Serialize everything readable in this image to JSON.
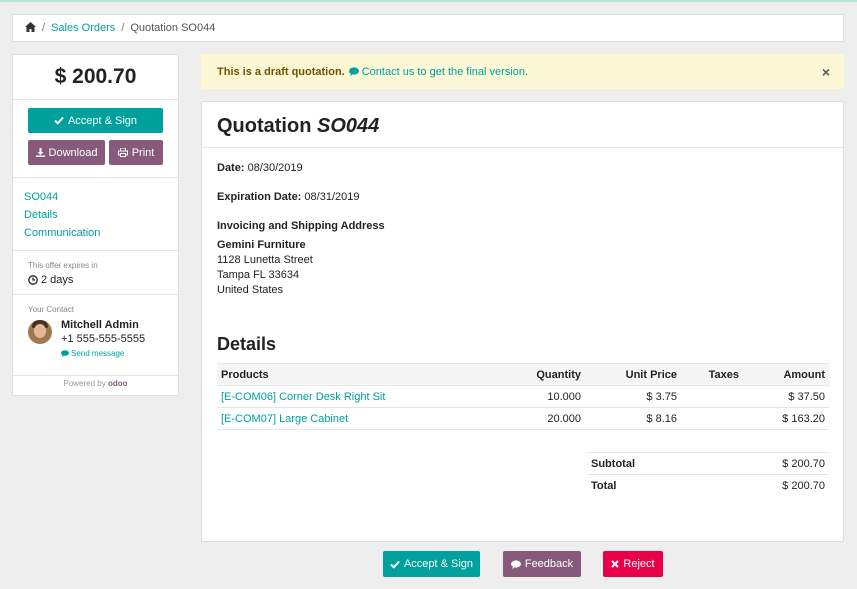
{
  "breadcrumb": {
    "home_icon": "home-icon",
    "items": [
      "Sales Orders"
    ],
    "current": "Quotation SO044"
  },
  "sidebar": {
    "amount": "$ 200.70",
    "accept_label": "Accept & Sign",
    "download_label": "Download",
    "print_label": "Print",
    "nav": [
      "SO044",
      "Details",
      "Communication"
    ],
    "expire_label": "This offer expires in",
    "expire_value": "2 days",
    "contact_label": "Your Contact",
    "contact_name": "Mitchell Admin",
    "contact_phone": "+1 555-555-5555",
    "send_message": "Send message",
    "powered_by": "Powered by",
    "powered_brand": "odoo"
  },
  "alert": {
    "text": "This is a draft quotation.",
    "link": "Contact us to get the final version.",
    "close": "×"
  },
  "quotation": {
    "title_prefix": "Quotation",
    "number": "SO044",
    "date_label": "Date:",
    "date_value": "08/30/2019",
    "exp_label": "Expiration Date:",
    "exp_value": "08/31/2019",
    "address_title": "Invoicing and Shipping Address",
    "address": [
      "Gemini Furniture",
      "1128 Lunetta Street",
      "Tampa FL 33634",
      "United States"
    ],
    "details_title": "Details",
    "columns": [
      "Products",
      "Quantity",
      "Unit Price",
      "Taxes",
      "Amount"
    ],
    "lines": [
      {
        "product": "[E-COM06] Corner Desk Right Sit",
        "quantity": "10.000",
        "unit_price": "$ 3.75",
        "taxes": "",
        "amount": "$ 37.50"
      },
      {
        "product": "[E-COM07] Large Cabinet",
        "quantity": "20.000",
        "unit_price": "$ 8.16",
        "taxes": "",
        "amount": "$ 163.20"
      }
    ],
    "subtotal_label": "Subtotal",
    "subtotal_value": "$ 200.70",
    "total_label": "Total",
    "total_value": "$ 200.70"
  },
  "bottom": {
    "accept_label": "Accept & Sign",
    "feedback_label": "Feedback",
    "reject_label": "Reject"
  },
  "colors": {
    "accent": "#00a09d",
    "purple": "#875a7b",
    "reject": "#e8004a",
    "alert_bg": "#fcf8d6"
  }
}
